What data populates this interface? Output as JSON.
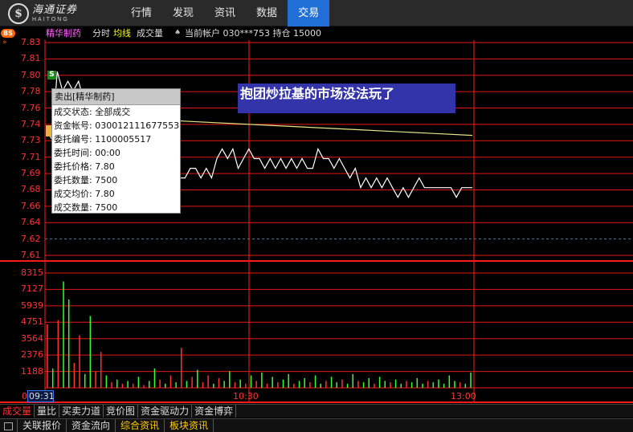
{
  "brand": {
    "cn": "海通证券",
    "en": "HAITONG",
    "logo_glyph": "$"
  },
  "nav": {
    "items": [
      "行情",
      "发现",
      "资讯",
      "数据",
      "交易"
    ],
    "active": "交易"
  },
  "header": {
    "bs_badge": "BS",
    "stock_name": "精华制药",
    "fenshi": "分时",
    "junxian": "均线",
    "volume": "成交量",
    "account_icon": "spade-icon",
    "account_text": "当前帐户 030***753 持仓 15000"
  },
  "price_labels": [
    "7.83",
    "7.81",
    "7.80",
    "7.78",
    "7.76",
    "7.74",
    "7.73",
    "7.71",
    "7.69",
    "7.68",
    "7.66",
    "7.64",
    "7.62",
    "7.61"
  ],
  "volume_labels": [
    "8315",
    "7127",
    "5939",
    "4751",
    "3564",
    "2376",
    "1188"
  ],
  "time_axis": {
    "start_prefix": "0",
    "start_box": "09:31",
    "mid": "10:30",
    "end": "13:00"
  },
  "marker_s": "S",
  "popup": {
    "title": "卖出[精华制药]",
    "rows": [
      "成交状态: 全部成交",
      "资金帐号: 030012111677553",
      "委托编号: 1100005517",
      "委托时间: 00:00",
      "委托价格: 7.80",
      "委托数量: 7500",
      "成交均价: 7.80",
      "成交数量: 7500"
    ]
  },
  "banner": "抱团炒拉基的市场没法玩了",
  "tabs_row1": [
    "成交量",
    "量比",
    "买卖力道",
    "竞价图",
    "资金驱动力",
    "资金博弈"
  ],
  "tabs_row1_active": "成交量",
  "tabs_row2": [
    "关联报价",
    "资金流向",
    "综合资讯",
    "板块资讯"
  ],
  "colors": {
    "grid": "#ff1a1a",
    "price_line": "#ffffff",
    "avg_line": "#e6e68a",
    "up_bar": "#ff3333",
    "down_bar": "#33ff33",
    "nav_active": "#1f6fd6",
    "banner": "#3333aa"
  },
  "chart_data": {
    "type": "line",
    "title": "精华制药 分时",
    "price_range": [
      7.61,
      7.83
    ],
    "volume_range": [
      0,
      8315
    ],
    "series": [
      {
        "name": "分时",
        "values": [
          7.74,
          7.73,
          7.8,
          7.78,
          7.79,
          7.78,
          7.79,
          7.77,
          7.78,
          7.76,
          7.77,
          7.75,
          7.76,
          7.75,
          7.74,
          7.75,
          7.74,
          7.74,
          7.75,
          7.74,
          7.73,
          7.74,
          7.73,
          7.71,
          7.7,
          7.69,
          7.69,
          7.7,
          7.7,
          7.69,
          7.7,
          7.69,
          7.71,
          7.72,
          7.71,
          7.72,
          7.7,
          7.71,
          7.72,
          7.71,
          7.71,
          7.7,
          7.71,
          7.7,
          7.71,
          7.7,
          7.71,
          7.7,
          7.71,
          7.7,
          7.7,
          7.72,
          7.71,
          7.71,
          7.7,
          7.71,
          7.7,
          7.69,
          7.7,
          7.68,
          7.69,
          7.68,
          7.69,
          7.68,
          7.69,
          7.68,
          7.67,
          7.68,
          7.67,
          7.68,
          7.69,
          7.68,
          7.68,
          7.68,
          7.68,
          7.68,
          7.68,
          7.67,
          7.68,
          7.68,
          7.68
        ]
      },
      {
        "name": "均线",
        "values": [
          7.75,
          7.748,
          7.746,
          7.744,
          7.742,
          7.74,
          7.738,
          7.736,
          7.734
        ]
      }
    ],
    "volume": [
      {
        "v": 4600,
        "up": true
      },
      {
        "v": 1400,
        "up": false
      },
      {
        "v": 4900,
        "up": true
      },
      {
        "v": 7700,
        "up": false
      },
      {
        "v": 6400,
        "up": false
      },
      {
        "v": 1800,
        "up": true
      },
      {
        "v": 3800,
        "up": true
      },
      {
        "v": 1000,
        "up": false
      },
      {
        "v": 5200,
        "up": false
      },
      {
        "v": 1200,
        "up": true
      },
      {
        "v": 2600,
        "up": true
      },
      {
        "v": 900,
        "up": false
      },
      {
        "v": 400,
        "up": true
      },
      {
        "v": 600,
        "up": false
      },
      {
        "v": 300,
        "up": true
      },
      {
        "v": 500,
        "up": false
      },
      {
        "v": 300,
        "up": true
      },
      {
        "v": 800,
        "up": false
      },
      {
        "v": 200,
        "up": true
      },
      {
        "v": 500,
        "up": false
      },
      {
        "v": 1400,
        "up": false
      },
      {
        "v": 600,
        "up": true
      },
      {
        "v": 300,
        "up": false
      },
      {
        "v": 900,
        "up": true
      },
      {
        "v": 400,
        "up": false
      },
      {
        "v": 2900,
        "up": true
      },
      {
        "v": 500,
        "up": false
      },
      {
        "v": 800,
        "up": true
      },
      {
        "v": 1300,
        "up": false
      },
      {
        "v": 400,
        "up": true
      },
      {
        "v": 900,
        "up": true
      },
      {
        "v": 300,
        "up": false
      },
      {
        "v": 700,
        "up": true
      },
      {
        "v": 500,
        "up": false
      },
      {
        "v": 1200,
        "up": false
      },
      {
        "v": 400,
        "up": true
      },
      {
        "v": 600,
        "up": false
      },
      {
        "v": 300,
        "up": true
      },
      {
        "v": 900,
        "up": false
      },
      {
        "v": 500,
        "up": true
      },
      {
        "v": 1100,
        "up": false
      },
      {
        "v": 300,
        "up": true
      },
      {
        "v": 800,
        "up": false
      },
      {
        "v": 400,
        "up": true
      },
      {
        "v": 600,
        "up": false
      },
      {
        "v": 1000,
        "up": false
      },
      {
        "v": 300,
        "up": true
      },
      {
        "v": 500,
        "up": false
      },
      {
        "v": 700,
        "up": false
      },
      {
        "v": 400,
        "up": true
      },
      {
        "v": 900,
        "up": false
      },
      {
        "v": 300,
        "up": false
      },
      {
        "v": 500,
        "up": true
      },
      {
        "v": 800,
        "up": false
      },
      {
        "v": 400,
        "up": false
      },
      {
        "v": 600,
        "up": true
      },
      {
        "v": 300,
        "up": false
      },
      {
        "v": 1000,
        "up": false
      },
      {
        "v": 500,
        "up": true
      },
      {
        "v": 400,
        "up": false
      },
      {
        "v": 700,
        "up": false
      },
      {
        "v": 300,
        "up": true
      },
      {
        "v": 800,
        "up": false
      },
      {
        "v": 500,
        "up": false
      },
      {
        "v": 400,
        "up": true
      },
      {
        "v": 600,
        "up": false
      },
      {
        "v": 300,
        "up": false
      },
      {
        "v": 500,
        "up": true
      },
      {
        "v": 400,
        "up": false
      },
      {
        "v": 700,
        "up": false
      },
      {
        "v": 300,
        "up": false
      },
      {
        "v": 500,
        "up": true
      },
      {
        "v": 400,
        "up": false
      },
      {
        "v": 600,
        "up": false
      },
      {
        "v": 300,
        "up": false
      },
      {
        "v": 900,
        "up": false
      },
      {
        "v": 500,
        "up": false
      },
      {
        "v": 400,
        "up": true
      },
      {
        "v": 300,
        "up": false
      },
      {
        "v": 1100,
        "up": false
      }
    ]
  }
}
